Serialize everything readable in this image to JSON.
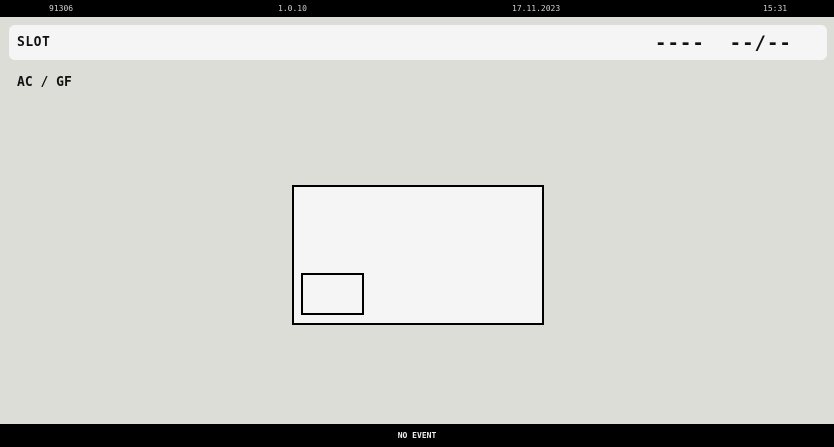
{
  "status_bar": {
    "id": "91306",
    "version": "1.0.10",
    "date": "17.11.2023",
    "time": "15:31"
  },
  "slot": {
    "label": "SLOT",
    "value": "----  --/--"
  },
  "mode": {
    "label": "AC / GF"
  },
  "footer": {
    "event": "NO EVENT"
  },
  "colors": {
    "background": "#dcddd7",
    "panel": "#f5f5f5",
    "bar": "#000000",
    "text": "#111111"
  }
}
